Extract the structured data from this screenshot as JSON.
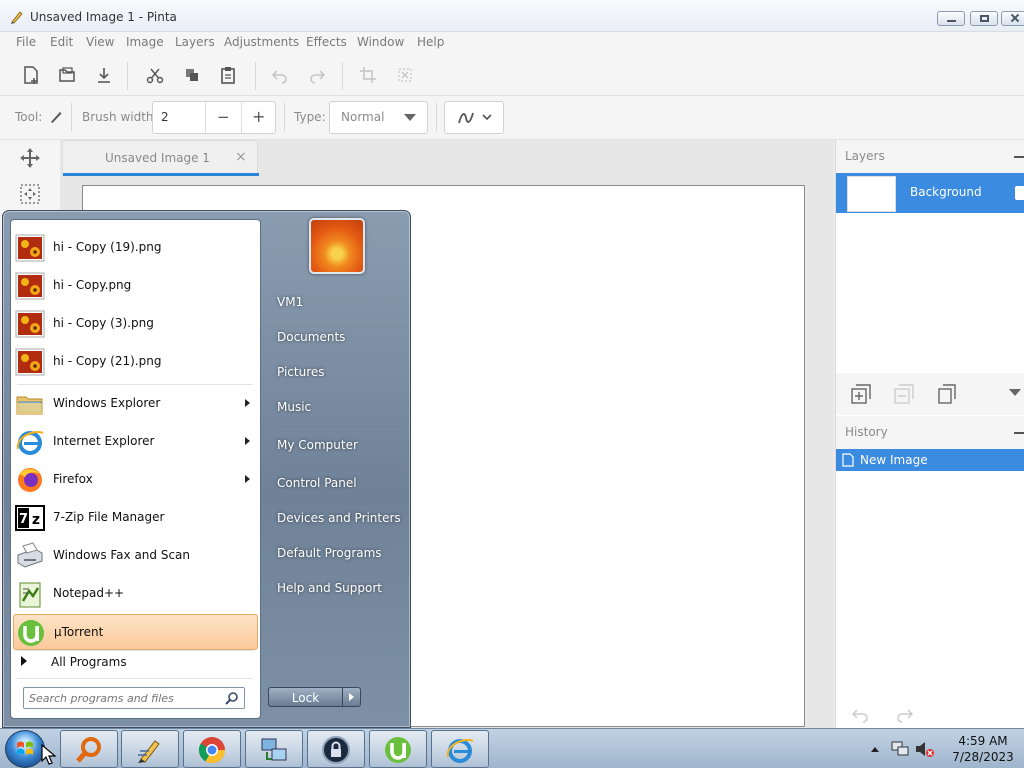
{
  "window": {
    "title": "Unsaved Image 1 - Pinta"
  },
  "menu": [
    "File",
    "Edit",
    "View",
    "Image",
    "Layers",
    "Adjustments",
    "Effects",
    "Window",
    "Help"
  ],
  "options_bar": {
    "tool_label": "Tool:",
    "brush_width_label": "Brush width:",
    "brush_width_value": "2",
    "minus": "−",
    "plus": "+",
    "type_label": "Type:",
    "type_value": "Normal"
  },
  "document_tab": {
    "label": "Unsaved Image 1",
    "close": "×"
  },
  "layers_panel": {
    "title": "Layers",
    "layer_name": "Background"
  },
  "history_panel": {
    "title": "History",
    "item": "New Image"
  },
  "start_menu": {
    "recent_files": [
      "hi - Copy (19).png",
      "hi - Copy.png",
      "hi - Copy (3).png",
      "hi - Copy (21).png"
    ],
    "programs": [
      "Windows Explorer",
      "Internet Explorer",
      "Firefox",
      "7-Zip File Manager",
      "Windows Fax and Scan",
      "Notepad++",
      "µTorrent"
    ],
    "all_programs": "All Programs",
    "search_placeholder": "Search programs and files",
    "right_items": [
      "VM1",
      "Documents",
      "Pictures",
      "Music",
      "My Computer",
      "Control Panel",
      "Devices and Printers",
      "Default Programs",
      "Help and Support"
    ],
    "lock_label": "Lock"
  },
  "taskbar": {
    "time": "4:59 AM",
    "date": "7/28/2023"
  },
  "colors": {
    "accent_blue": "#3b8be0",
    "tab_underline": "#2c86d8",
    "highlight_orange": "#fbc99b"
  }
}
